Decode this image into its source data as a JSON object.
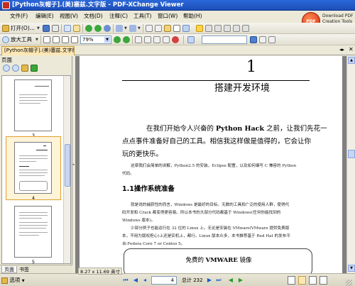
{
  "window": {
    "title": "[Python灰帽子].(美)塞兹.文字版 - PDF-XChange Viewer"
  },
  "menu": {
    "items": [
      "文件(F)",
      "编辑(E)",
      "视图(V)",
      "文档(D)",
      "注释(C)",
      "工具(T)",
      "窗口(W)",
      "帮助(H)"
    ]
  },
  "promo": {
    "badge": "PDF",
    "line1": "Download PDF",
    "line2": "Creation Tools"
  },
  "toolbar1": {
    "open_label": "打开(O)...",
    "icons": [
      "open-folder-icon",
      "save-icon",
      "print-icon",
      "email-icon",
      "snapshot-icon",
      "back-icon",
      "forward-icon",
      "undo-icon",
      "redo-icon",
      "find-icon",
      "hand-tool-icon",
      "select-text-icon",
      "snapshot-tool-icon",
      "comment-icon",
      "highlight-icon",
      "pen-icon"
    ]
  },
  "toolbar2": {
    "zoom_tool_label": "放大工具",
    "zoom_value": "79%",
    "search_value": ""
  },
  "tabs": {
    "document_tab": "[Python灰帽子].(美)塞兹.文字版"
  },
  "panel": {
    "header": "页面",
    "thumbnail_labels": [
      "3",
      "4",
      "5"
    ],
    "tab_pages": "页面",
    "tab_bookmarks": "书签"
  },
  "page": {
    "chapter_number": "1",
    "chapter_title": "搭建开发环境",
    "intro_line1_a": "在我们开始令人兴奋的 ",
    "intro_line1_b": "Python Hack",
    "intro_line1_c": " 之前，让我们先花一",
    "intro_line2": "点点事件准备好自己的工具。相信我这样做是值得的，它会让你",
    "intro_line3": "玩的更快乐。",
    "small_line1": "这章我们会简单的讲解，Python2.5 的安装，Eclipse 配置，以及如何编写 C 兼容的 Python",
    "small_line2": "代码。",
    "section_heading": "1.1操作系统准备",
    "body_lines": [
      "就是说的捕获性的而言，Windows 是最好的目标。无数的工具和广泛的使用人群，使得代",
      "码开发和 Crack 都变得更容易。所以本书的大部分代码都基于 Windows(任何你能找到的",
      "Windows 版本)。",
      "少部分例子也能运行在 32 位的 Linux 上。无论是安装在 VMware(VMware 提供免费版",
      "本，不用为版权担心)上还是实机上，都行。Linux 版本众多，本书推荐基于 Red Hat 的发布平",
      "台:Fedora Core 7 or Centos 5。"
    ],
    "vmware_box_title_a": "免费的 ",
    "vmware_box_title_b": "VMWARE",
    "vmware_box_title_c": " 镜像"
  },
  "status": {
    "options_label": "选项",
    "page_size": "8.27 x 11.69 英寸",
    "current_page": "4",
    "total_pages": "总计 232"
  }
}
